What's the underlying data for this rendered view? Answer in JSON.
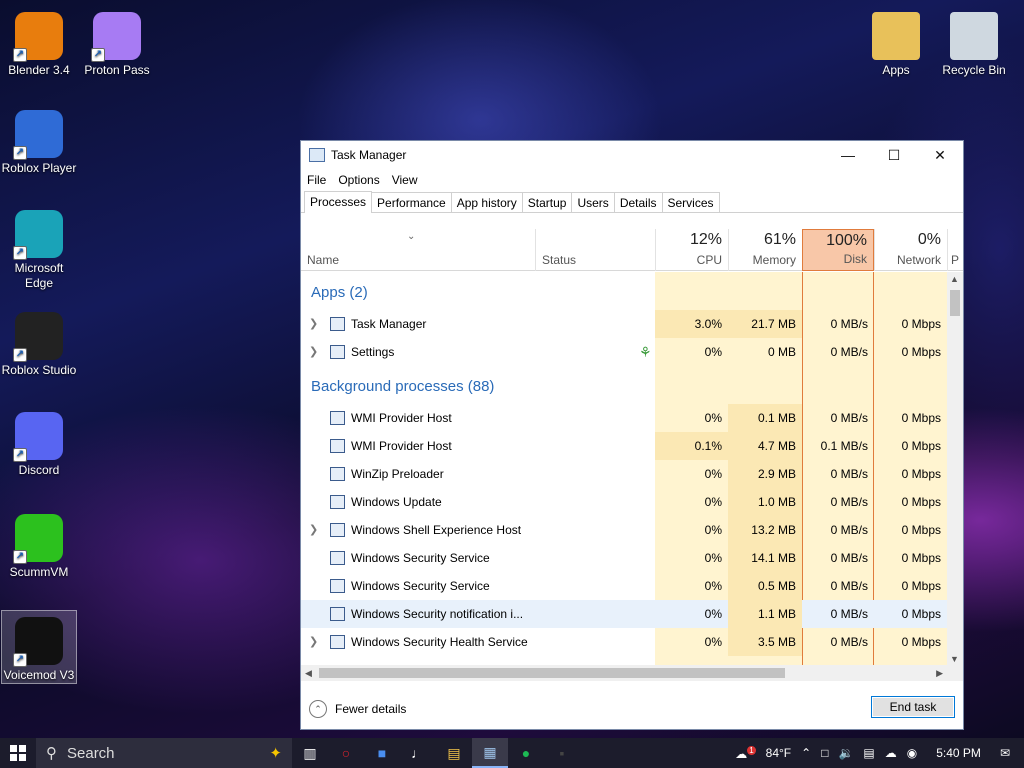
{
  "desktop": {
    "icons_left": [
      {
        "label": "Blender 3.4",
        "icon": "blender-icon",
        "color": "#e87d0d"
      },
      {
        "label": "Proton Pass",
        "icon": "proton-pass-icon",
        "color": "#a77bf3"
      },
      {
        "label": "Roblox Player",
        "icon": "roblox-icon",
        "color": "#2f6bd6"
      },
      {
        "label": "Microsoft Edge",
        "icon": "edge-icon",
        "color": "#1aa3b8"
      },
      {
        "label": "Roblox Studio",
        "icon": "roblox-studio-icon",
        "color": "#222222"
      },
      {
        "label": "Discord",
        "icon": "discord-icon",
        "color": "#5865f2"
      },
      {
        "label": "ScummVM",
        "icon": "scummvm-icon",
        "color": "#2cc11e"
      },
      {
        "label": "Voicemod V3",
        "icon": "voicemod-icon",
        "color": "#111111"
      }
    ],
    "icons_right": [
      {
        "label": "Apps",
        "icon": "folder-icon",
        "color": "#e8c15a"
      },
      {
        "label": "Recycle Bin",
        "icon": "recycle-bin-icon",
        "color": "#cfd8e0"
      }
    ]
  },
  "task_manager": {
    "title": "Task Manager",
    "menu": [
      "File",
      "Options",
      "View"
    ],
    "tabs": [
      "Processes",
      "Performance",
      "App history",
      "Startup",
      "Users",
      "Details",
      "Services"
    ],
    "active_tab": "Processes",
    "columns": {
      "name": "Name",
      "status": "Status",
      "cpu": {
        "pct": "12%",
        "label": "CPU"
      },
      "memory": {
        "pct": "61%",
        "label": "Memory"
      },
      "disk": {
        "pct": "100%",
        "label": "Disk"
      },
      "network": {
        "pct": "0%",
        "label": "Network"
      },
      "more": "P"
    },
    "groups": {
      "apps": "Apps (2)",
      "background": "Background processes (88)"
    },
    "apps": [
      {
        "name": "Task Manager",
        "expandable": true,
        "cpu": "3.0%",
        "memory": "21.7 MB",
        "disk": "0 MB/s",
        "network": "0 Mbps"
      },
      {
        "name": "Settings",
        "expandable": true,
        "cpu": "0%",
        "memory": "0 MB",
        "disk": "0 MB/s",
        "network": "0 Mbps"
      }
    ],
    "background": [
      {
        "name": "WMI Provider Host",
        "expandable": false,
        "cpu": "0%",
        "memory": "0.1 MB",
        "disk": "0 MB/s",
        "network": "0 Mbps"
      },
      {
        "name": "WMI Provider Host",
        "expandable": false,
        "cpu": "0.1%",
        "memory": "4.7 MB",
        "disk": "0.1 MB/s",
        "network": "0 Mbps"
      },
      {
        "name": "WinZip Preloader",
        "expandable": false,
        "cpu": "0%",
        "memory": "2.9 MB",
        "disk": "0 MB/s",
        "network": "0 Mbps"
      },
      {
        "name": "Windows Update",
        "expandable": false,
        "cpu": "0%",
        "memory": "1.0 MB",
        "disk": "0 MB/s",
        "network": "0 Mbps"
      },
      {
        "name": "Windows Shell Experience Host",
        "expandable": true,
        "cpu": "0%",
        "memory": "13.2 MB",
        "disk": "0 MB/s",
        "network": "0 Mbps"
      },
      {
        "name": "Windows Security Service",
        "expandable": false,
        "cpu": "0%",
        "memory": "14.1 MB",
        "disk": "0 MB/s",
        "network": "0 Mbps"
      },
      {
        "name": "Windows Security Service",
        "expandable": false,
        "cpu": "0%",
        "memory": "0.5 MB",
        "disk": "0 MB/s",
        "network": "0 Mbps"
      },
      {
        "name": "Windows Security notification i...",
        "expandable": false,
        "cpu": "0%",
        "memory": "1.1 MB",
        "disk": "0 MB/s",
        "network": "0 Mbps"
      },
      {
        "name": "Windows Security Health Service",
        "expandable": true,
        "cpu": "0%",
        "memory": "3.5 MB",
        "disk": "0 MB/s",
        "network": "0 Mbps"
      }
    ],
    "footer": {
      "fewer_details": "Fewer details",
      "end_task": "End task"
    },
    "colors": {
      "disk_header": "#f8c7a8",
      "disk_border": "#e07b3c",
      "heat_light": "#fff4d0",
      "heat_mid": "#fbe8b4"
    }
  },
  "taskbar": {
    "search": "Search",
    "weather": "84°F",
    "weather_badge": "1",
    "time": "5:40 PM",
    "apps": [
      "task-view-icon",
      "opera-icon",
      "roblox-icon",
      "piano-icon",
      "file-explorer-icon",
      "task-manager-icon",
      "spotify-icon",
      "unknown-app-icon"
    ]
  }
}
